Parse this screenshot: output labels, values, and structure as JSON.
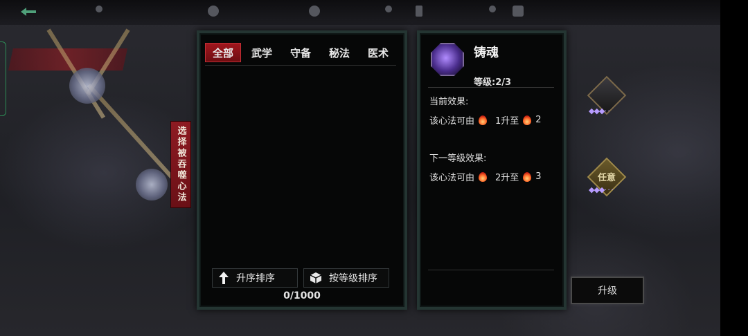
{
  "tabs": [
    "全部",
    "武学",
    "守备",
    "秘法",
    "医术"
  ],
  "active_tab": 0,
  "side_label": "选择被吞噬心法",
  "sort": {
    "ascending_label": "升序排序",
    "by_level_label": "按等级排序"
  },
  "count": "0/1000",
  "skill": {
    "name": "铸魂",
    "level": "等级:2/3",
    "current_effect_title": "当前效果:",
    "current_effect": {
      "prefix": "该心法可由",
      "from": "1升至",
      "to": "2"
    },
    "next_effect_title": "下一等级效果:",
    "next_effect": {
      "prefix": "该心法可由",
      "from": "2升至",
      "to": "3"
    }
  },
  "slots": [
    {
      "label": "",
      "pips": "◆◆◆· ·"
    },
    {
      "label": "任意",
      "pips": "◆◆◆· · ·"
    }
  ],
  "upgrade_label": "升级",
  "icons": {
    "back": "back-arrow-icon",
    "up_arrow": "up-arrow-icon",
    "box": "box-icon",
    "flame": "flame-icon",
    "skill": "purple-skill-icon"
  },
  "colors": {
    "tab_active": "#a0161d",
    "panel_border": "#243532",
    "flame": "#ff6a2a",
    "pips": "#b79cff"
  }
}
